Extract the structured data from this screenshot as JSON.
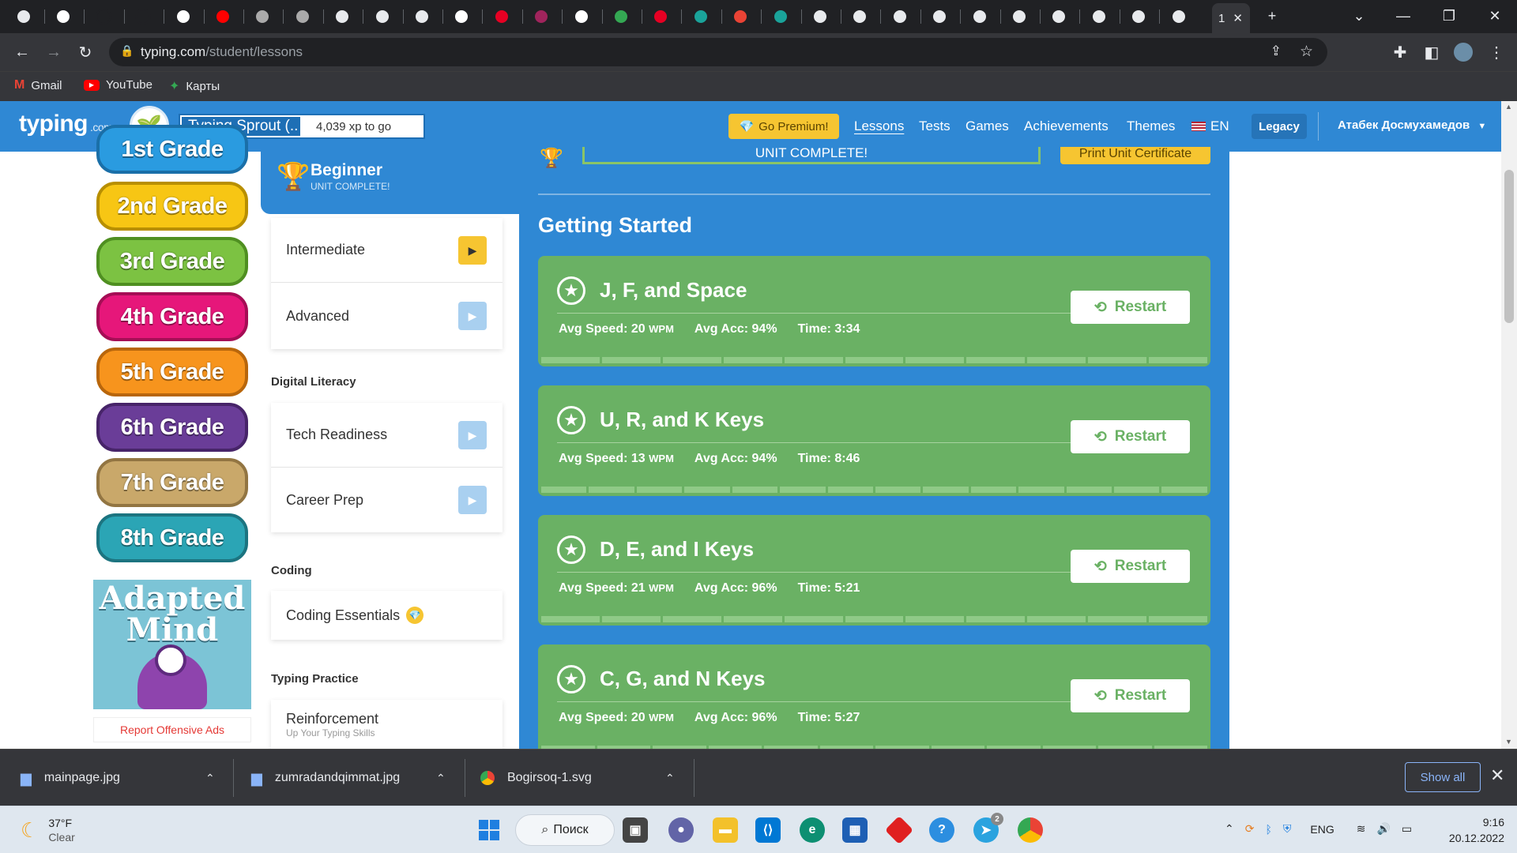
{
  "browser": {
    "active_tab_label": "1",
    "url_host": "typing.com",
    "url_path": "/student/lessons",
    "bookmarks": [
      {
        "label": "Gmail"
      },
      {
        "label": "YouTube"
      },
      {
        "label": "Карты"
      }
    ]
  },
  "header": {
    "logo_text": "typing",
    "logo_suffix": ".com",
    "rank_name": "Typing Sprout (",
    "rank_ellipsis": "..",
    "xp_to_go": "4,039 xp to go",
    "premium_label": "Go Premium!",
    "nav": [
      "Lessons",
      "Tests",
      "Games",
      "Achievements",
      "Themes"
    ],
    "language": "EN",
    "legacy_label": "Legacy",
    "username": "Атабек Досмухамедов"
  },
  "grades": [
    {
      "label": "1st Grade",
      "bg": "#2a9be0",
      "border": "#1a6fa8"
    },
    {
      "label": "2nd Grade",
      "bg": "#f7c614",
      "border": "#b88f00"
    },
    {
      "label": "3rd Grade",
      "bg": "#7cc242",
      "border": "#4f8f21"
    },
    {
      "label": "4th Grade",
      "bg": "#e6177a",
      "border": "#a50d55"
    },
    {
      "label": "5th Grade",
      "bg": "#f7941d",
      "border": "#b8660b"
    },
    {
      "label": "6th Grade",
      "bg": "#6a3d98",
      "border": "#472469"
    },
    {
      "label": "7th Grade",
      "bg": "#c9a86a",
      "border": "#927542"
    },
    {
      "label": "8th Grade",
      "bg": "#2ba5b5",
      "border": "#1c7480"
    }
  ],
  "ad": {
    "title_line1": "Adapted",
    "title_line2": "Mind",
    "report_label": "Report Offensive Ads"
  },
  "units": {
    "current_title": "Beginner",
    "current_status": "UNIT COMPLETE!",
    "intermediate": "Intermediate",
    "advanced": "Advanced",
    "digital_literacy_heading": "Digital Literacy",
    "tech_readiness": "Tech Readiness",
    "career_prep": "Career Prep",
    "coding_heading": "Coding",
    "coding_essentials": "Coding Essentials",
    "typing_practice_heading": "Typing Practice",
    "reinforcement": "Reinforcement",
    "reinforcement_sub": "Up Your Typing Skills"
  },
  "main": {
    "unit_complete_banner": "UNIT COMPLETE!",
    "print_certificate": "Print Unit Certificate",
    "section_title": "Getting Started",
    "restart_label": "Restart",
    "lessons": [
      {
        "title": "J, F, and Space",
        "speed": "20",
        "acc": "94%",
        "time": "3:34",
        "segments": 11
      },
      {
        "title": "U, R, and K Keys",
        "speed": "13",
        "acc": "94%",
        "time": "8:46",
        "segments": 14
      },
      {
        "title": "D, E, and I Keys",
        "speed": "21",
        "acc": "96%",
        "time": "5:21",
        "segments": 11
      },
      {
        "title": "C, G, and N Keys",
        "speed": "20",
        "acc": "96%",
        "time": "5:27",
        "segments": 12
      }
    ],
    "labels": {
      "avg_speed": "Avg Speed:",
      "wpm": "WPM",
      "avg_acc": "Avg Acc:",
      "time": "Time:"
    }
  },
  "downloads": {
    "items": [
      {
        "name": "mainpage.jpg"
      },
      {
        "name": "zumradandqimmat.jpg"
      },
      {
        "name": "Bogirsoq-1.svg"
      }
    ],
    "show_all": "Show all"
  },
  "taskbar": {
    "temperature": "37°F",
    "condition": "Clear",
    "search_label": "Поиск",
    "lang": "ENG",
    "time": "9:16",
    "date": "20.12.2022",
    "telegram_badge": "2"
  }
}
